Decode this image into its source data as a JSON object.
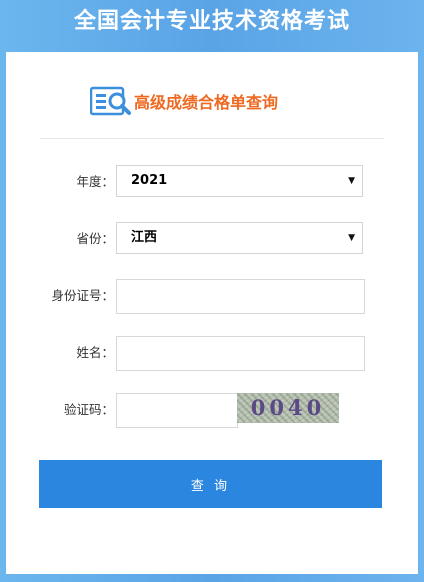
{
  "header": {
    "site_title": "全国会计专业技术资格考试"
  },
  "query": {
    "title": "高级成绩合格单查询"
  },
  "form": {
    "year": {
      "label": "年度：",
      "value": "2021"
    },
    "province": {
      "label": "省份：",
      "value": "江西"
    },
    "id_number": {
      "label": "身份证号：",
      "value": ""
    },
    "name": {
      "label": "姓名：",
      "value": ""
    },
    "captcha": {
      "label": "验证码：",
      "value": "",
      "code": "0040"
    }
  },
  "submit_label": "查 询",
  "colors": {
    "page_background": "#5aa3e6",
    "title_orange": "#ee6a22",
    "button_blue": "#2b86e0",
    "icon_blue": "#3b8fdc"
  }
}
